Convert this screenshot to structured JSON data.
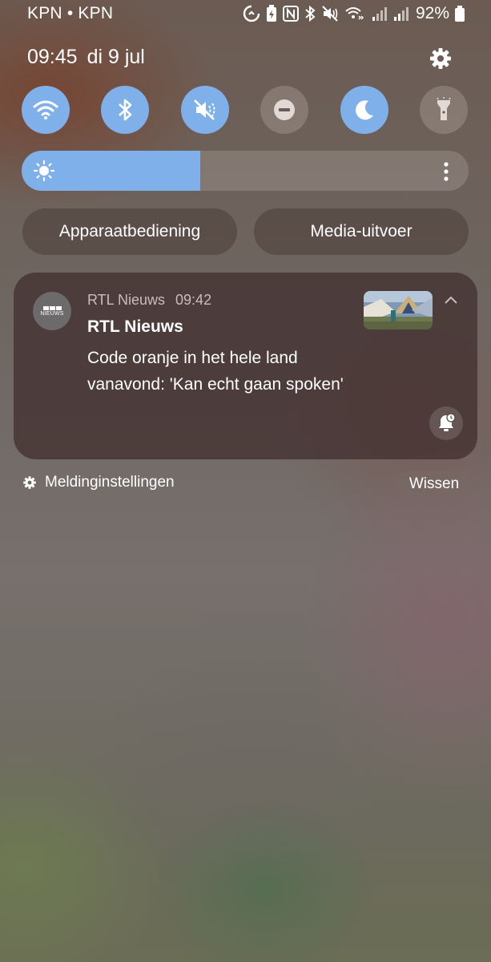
{
  "status_bar": {
    "carrier": "KPN • KPN",
    "battery_percent": "92%",
    "icons": [
      "data-saver-icon",
      "battery-saver-icon",
      "nfc-icon",
      "bluetooth-icon",
      "mute-icon",
      "wifi-calling-icon",
      "signal-icon",
      "signal-icon",
      "battery-icon"
    ]
  },
  "header": {
    "time": "09:45",
    "date": "di 9 jul"
  },
  "quick_toggles": [
    {
      "name": "wifi",
      "state": "on"
    },
    {
      "name": "bluetooth",
      "state": "on"
    },
    {
      "name": "mute",
      "state": "on"
    },
    {
      "name": "do-not-disturb",
      "state": "off"
    },
    {
      "name": "dark-mode",
      "state": "on"
    },
    {
      "name": "flashlight",
      "state": "off"
    }
  ],
  "brightness": {
    "level_percent": 40
  },
  "buttons": {
    "device_control": "Apparaatbediening",
    "media_output": "Media-uitvoer"
  },
  "notification": {
    "app_name": "RTL Nieuws",
    "time": "09:42",
    "title": "RTL Nieuws",
    "body": "Code oranje in het hele land vanavond: 'Kan echt gaan spoken'",
    "icon_text": "NIEUWS"
  },
  "footer": {
    "settings_label": "Meldinginstellingen",
    "clear_label": "Wissen"
  },
  "colors": {
    "toggle_on": "#7fb0ea",
    "card_bg": "#3e2d2d"
  }
}
